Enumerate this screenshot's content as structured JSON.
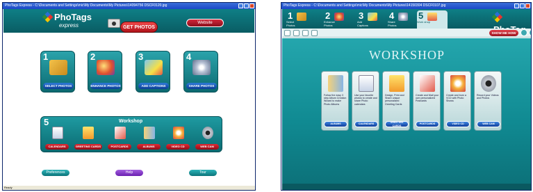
{
  "left_window": {
    "title": "PhoTags Express - C:\\Documents and Settings\\mic\\My Documents\\My Pictures\\14094756 DSCF0120.jpg",
    "logo_name": "PhoTags",
    "logo_sub": "express",
    "get_photos_label": "GET PHOTOS",
    "website_label": "Website",
    "tiles": [
      {
        "num": "1",
        "label": "SELECT PHOTOS"
      },
      {
        "num": "2",
        "label": "ENHANCE PHOTOS"
      },
      {
        "num": "3",
        "label": "ADD CAPTIONS"
      },
      {
        "num": "4",
        "label": "SHARE PHOTOS"
      }
    ],
    "workshop": {
      "num": "5",
      "title": "Workshop",
      "items": [
        "CALENDARS",
        "GREETING CARDS",
        "POSTCARDS",
        "ALBUMS",
        "VIDEO CD",
        "WEB CAM"
      ]
    },
    "preferences_label": "Preferences",
    "help_label": "Help",
    "tour_label": "Tour",
    "status_text": "Ready"
  },
  "right_window": {
    "title": "PhoTags Express - C:\\Documents and Settings\\mic\\My Documents\\My Pictures\\14150304 DSCF0107.jpg",
    "logo_name": "PhoTag",
    "logo_sub": "express",
    "steps": [
      {
        "num": "1",
        "text": "Select Photos"
      },
      {
        "num": "2",
        "text": "Enhance Photos"
      },
      {
        "num": "3",
        "text": "Add Captions"
      },
      {
        "num": "4",
        "text": "Share Photos"
      },
      {
        "num": "5",
        "text": "Work shop"
      }
    ],
    "show_me_how_label": "SHOW ME HOW",
    "workshop_title": "WORKSHOP",
    "cards": [
      {
        "desc": "Follow the easy 3 step Album Creation Wizard to make Photo Albums",
        "button": "ALBUMS"
      },
      {
        "desc": "Use your favorite photos to create and share Photo calendars",
        "button": "CALENDARS"
      },
      {
        "desc": "Design, Print and Share unique personalized Greeting Cards",
        "button": "GREETING CARDS"
      },
      {
        "desc": "Create and Mail your own personalized Postcards",
        "button": "POSTCARDS"
      },
      {
        "desc": "Create and burn a VCD with Photo Shows",
        "button": "VIDEO CD"
      },
      {
        "desc": "Record your Videos and Photos",
        "button": "WEB CAM"
      }
    ]
  },
  "colors": {
    "teal_dark": "#0a5c63",
    "teal_light": "#24a6ad",
    "accent_red": "#d3273a",
    "button_blue": "#2c7ad8",
    "titlebar_blue": "#1c48c8"
  }
}
